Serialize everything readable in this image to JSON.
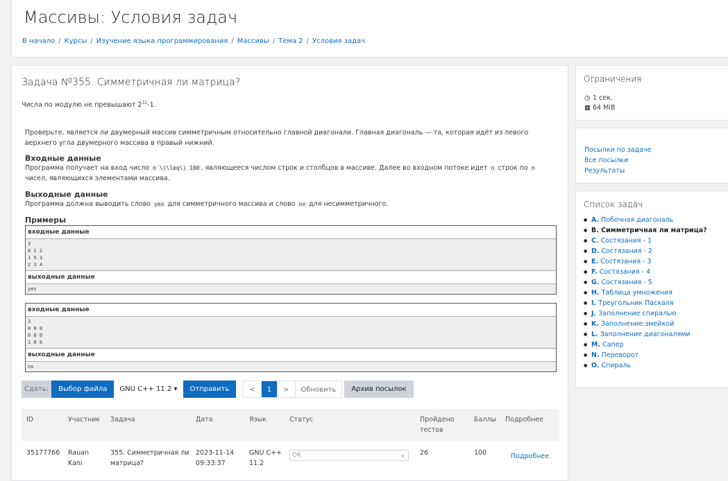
{
  "header": {
    "title": "Массивы: Условия задач",
    "breadcrumb": [
      "В начало",
      "Курсы",
      "Изучение языка программирования",
      "Массивы",
      "Тема 2",
      "Условия задач"
    ]
  },
  "problem": {
    "title": "Задача №355. Симметричная ли матрица?",
    "limit_text_pre": "Числа по модулю не превышают 2",
    "limit_exp": "31",
    "limit_text_post": "-1.",
    "statement": "Проверьте, является ли двумерный массив симметричным относительно главной диагонали. Главная диагональ — та, которая идёт из левого верхнего угла двумерного массива в правый нижний.",
    "input_heading": "Входные данные",
    "input_pre": "Программа получает на вход число ",
    "input_code1": "n \\(\\leq\\) 100",
    "input_mid": ", являющееся числом строк и столбцов в массиве. Далее во входном потоке идет ",
    "input_code2": "n",
    "input_mid2": " строк по ",
    "input_code3": "n",
    "input_post": " чисел, являющихся элементами массива.",
    "output_heading": "Выходные данные",
    "output_pre": "Программа должна выводить слово ",
    "output_code1": "yes",
    "output_mid": " для симметричного массива и слово ",
    "output_code2": "no",
    "output_post": " для несимметричного.",
    "examples_heading": "Примеры",
    "input_label": "входные данные",
    "output_label": "выходные данные",
    "examples": [
      {
        "input": "3\n0 1 2\n1 5 3\n2 3 4",
        "output": "yes"
      },
      {
        "input": "3\n0 0 0\n0 0 0\n1 0 0",
        "output": "no"
      }
    ]
  },
  "submit": {
    "label": "Сдать:",
    "choose_file": "Выбор файла",
    "language": "GNU C++ 11.2",
    "send": "Отправить",
    "prev": "<",
    "page": "1",
    "next": ">",
    "refresh": "Обновить",
    "archive": "Архив посылок"
  },
  "submissions": {
    "columns": [
      "ID",
      "Участник",
      "Задача",
      "Дата",
      "Язык",
      "Статус",
      "Пройдено тестов",
      "Баллы",
      "Подробнее"
    ],
    "rows": [
      {
        "id": "35177766",
        "user": "Rauan Kani",
        "task": "355. Симметричная ли матрица?",
        "date": "2023-11-14 09:33:37",
        "lang": "GNU C++ 11.2",
        "status": "OK",
        "tests": "26",
        "score": "100",
        "details": "Подробнее"
      }
    ]
  },
  "limits": {
    "title": "Ограничения",
    "time": "1 сек.",
    "memory": "64 MiB",
    "time_icon": "clock-icon",
    "memory_icon": "table-icon"
  },
  "links": [
    "Посылки по задаче",
    "Все посылки",
    "Результаты"
  ],
  "task_list": {
    "title": "Список задач",
    "items": [
      {
        "letter": "A.",
        "name": "Побочная диагональ"
      },
      {
        "letter": "B.",
        "name": "Симметричная ли матрица?",
        "current": true
      },
      {
        "letter": "C.",
        "name": "Состязания - 1"
      },
      {
        "letter": "D.",
        "name": "Состязания - 2"
      },
      {
        "letter": "E.",
        "name": "Состязания - 3"
      },
      {
        "letter": "F.",
        "name": "Состязания - 4"
      },
      {
        "letter": "G.",
        "name": "Состязания - 5"
      },
      {
        "letter": "H.",
        "name": "Таблица умножения"
      },
      {
        "letter": "I.",
        "name": "Треугольник Паскаля"
      },
      {
        "letter": "J.",
        "name": "Заполнение спиралью"
      },
      {
        "letter": "K.",
        "name": "Заполнение змейкой"
      },
      {
        "letter": "L.",
        "name": "Заполнение диагоналями"
      },
      {
        "letter": "M.",
        "name": "Сапер"
      },
      {
        "letter": "N.",
        "name": "Переворот"
      },
      {
        "letter": "O.",
        "name": "Спираль"
      }
    ]
  },
  "colors": {
    "accent": "#0f6cbf",
    "background": "#f2f2f2"
  }
}
